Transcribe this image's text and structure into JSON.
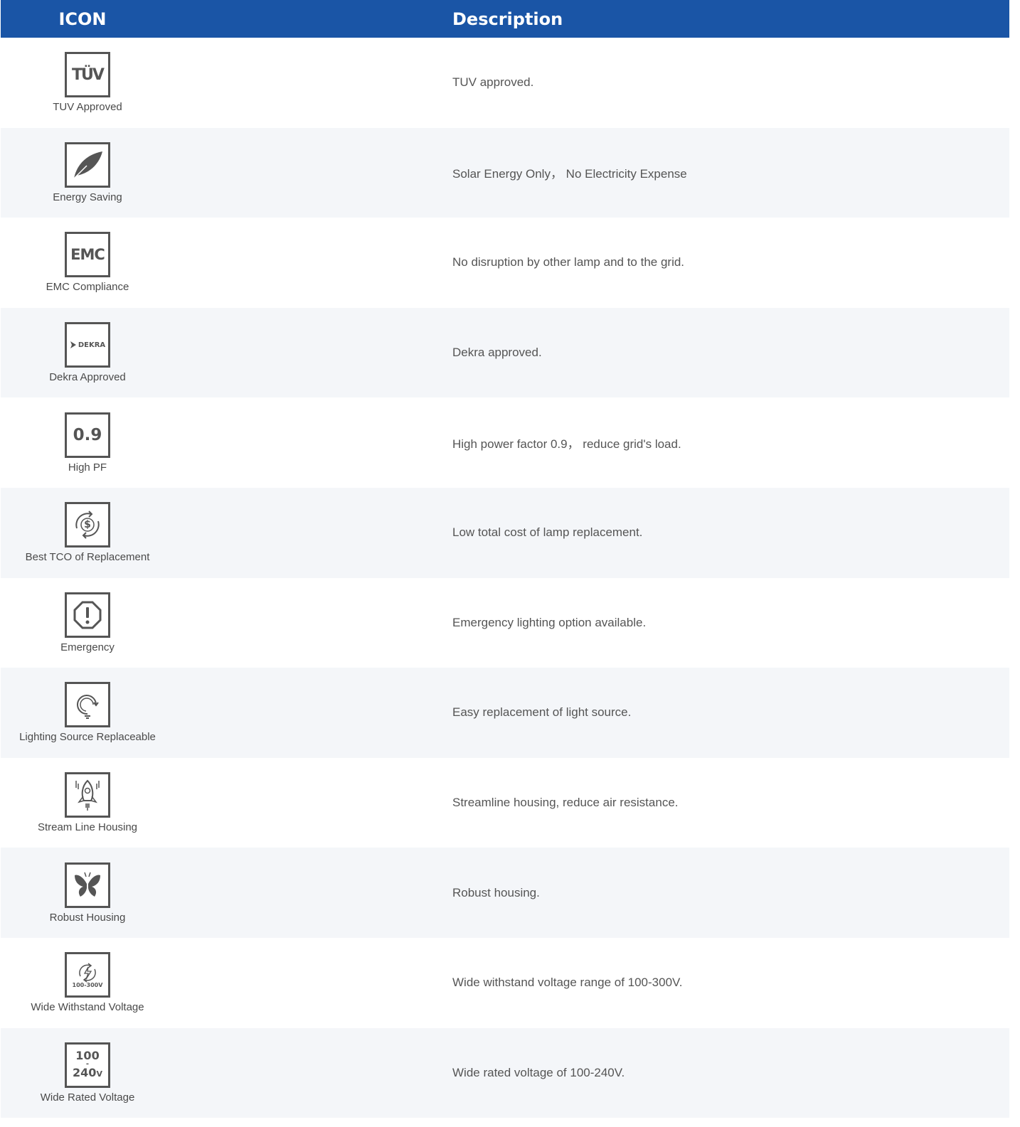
{
  "header": {
    "icon_col": "ICON",
    "desc_col": "Description"
  },
  "rows": [
    {
      "icon": "tuv-logo-icon",
      "label": "TUV Approved",
      "description": "TUV approved."
    },
    {
      "icon": "leaf-icon",
      "label": "Energy Saving",
      "description": "Solar Energy Only， No Electricity Expense"
    },
    {
      "icon": "emc-logo-icon",
      "label": "EMC Compliance",
      "description": "No disruption by other lamp and to the grid."
    },
    {
      "icon": "dekra-logo-icon",
      "label": "Dekra Approved",
      "description": "Dekra approved."
    },
    {
      "icon": "power-factor-icon",
      "label": "High PF",
      "description": "High power factor 0.9， reduce grid's load."
    },
    {
      "icon": "dollar-cycle-icon",
      "label": "Best TCO of Replacement",
      "description": "Low total cost of lamp replacement."
    },
    {
      "icon": "emergency-alert-icon",
      "label": "Emergency",
      "description": "Emergency lighting option available."
    },
    {
      "icon": "bulb-replace-icon",
      "label": "Lighting Source Replaceable",
      "description": "Easy replacement of light source."
    },
    {
      "icon": "rocket-icon",
      "label": "Stream Line Housing",
      "description": "Streamline housing, reduce air resistance."
    },
    {
      "icon": "butterfly-icon",
      "label": "Robust Housing",
      "description": "Robust housing."
    },
    {
      "icon": "voltage-cycle-icon",
      "label": "Wide Withstand Voltage",
      "description": "Wide withstand voltage range of 100-300V."
    },
    {
      "icon": "rated-voltage-icon",
      "label": "Wide Rated Voltage",
      "description": "Wide rated  voltage of 100-240V."
    }
  ],
  "icon_text": {
    "tuv": "TÜV",
    "emc": "EMC",
    "dekra": "DEKRA",
    "pf": "0.9",
    "dollar": "$",
    "withstand": "100-300V",
    "rated_top": "100",
    "rated_dash": "-",
    "rated_bottom": "240",
    "rated_unit": "V"
  },
  "colors": {
    "header_bg": "#1a55a6",
    "alt_row_bg": "#f4f6f9",
    "icon_stroke": "#555555"
  }
}
